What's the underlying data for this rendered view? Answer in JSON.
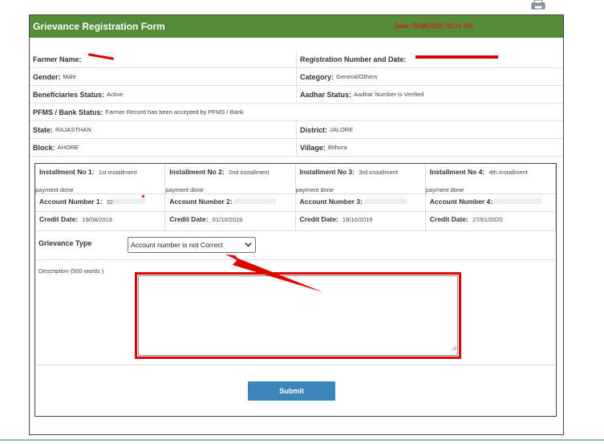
{
  "form": {
    "title": "Grievance Registration Form",
    "date_stamp": "Date: 05/06/2020 02:14 PM"
  },
  "info": {
    "farmer_name_label": "Farmer Name:",
    "farmer_name_value": "",
    "registration_label": "Registration Number and Date:",
    "registration_value": "",
    "gender_label": "Gender:",
    "gender_value": "Male",
    "category_label": "Category:",
    "category_value": "General/Others",
    "beneficiaries_label": "Beneficiaries Status:",
    "beneficiaries_value": "Active",
    "aadhar_label": "Aadhar Status:",
    "aadhar_value": "Aadhar Number is Verified",
    "pfms_label": "PFMS / Bank Status:",
    "pfms_value": "Farmer Record has been accepted by PFMS / Bank",
    "state_label": "State:",
    "state_value": "RAJASTHAN",
    "district_label": "District:",
    "district_value": "JALORE",
    "block_label": "Block:",
    "block_value": "AHORE",
    "village_label": "Village:",
    "village_value": "Bithura"
  },
  "installments": [
    {
      "title_label": "Installment No 1:",
      "title_value": "1st installment",
      "done": "payment done",
      "acct_label": "Account Number 1:",
      "acct_value": "328",
      "credit_label": "Credit Date:",
      "credit_value": "19/08/2019"
    },
    {
      "title_label": "Installment No 2:",
      "title_value": "2nd installment",
      "done": "payment done",
      "acct_label": "Account Number 2:",
      "acct_value": "",
      "credit_label": "Credit Date:",
      "credit_value": "01/10/2019"
    },
    {
      "title_label": "Installment No 3:",
      "title_value": "3rd installment",
      "done": "payment done",
      "acct_label": "Account Number 3:",
      "acct_value": "",
      "credit_label": "Credit Date:",
      "credit_value": "18/10/2019"
    },
    {
      "title_label": "Installment No 4:",
      "title_value": "4th installment",
      "done": "payment done",
      "acct_label": "Account Number 4:",
      "acct_value": "",
      "credit_label": "Credit Date:",
      "credit_value": "27/01/2020"
    }
  ],
  "grievance": {
    "label": "Grievance Type",
    "selected": "Account number is not Correct"
  },
  "description": {
    "label": "Description (500 words )",
    "value": ""
  },
  "submit_label": "Submit",
  "colors": {
    "header_bg": "#548c3a",
    "submit_bg": "#3b87bd",
    "highlight": "#e00000",
    "date_text": "#ff0000"
  },
  "icons": [
    "print-icon",
    "chevron-down-icon",
    "resize-handle-icon"
  ]
}
